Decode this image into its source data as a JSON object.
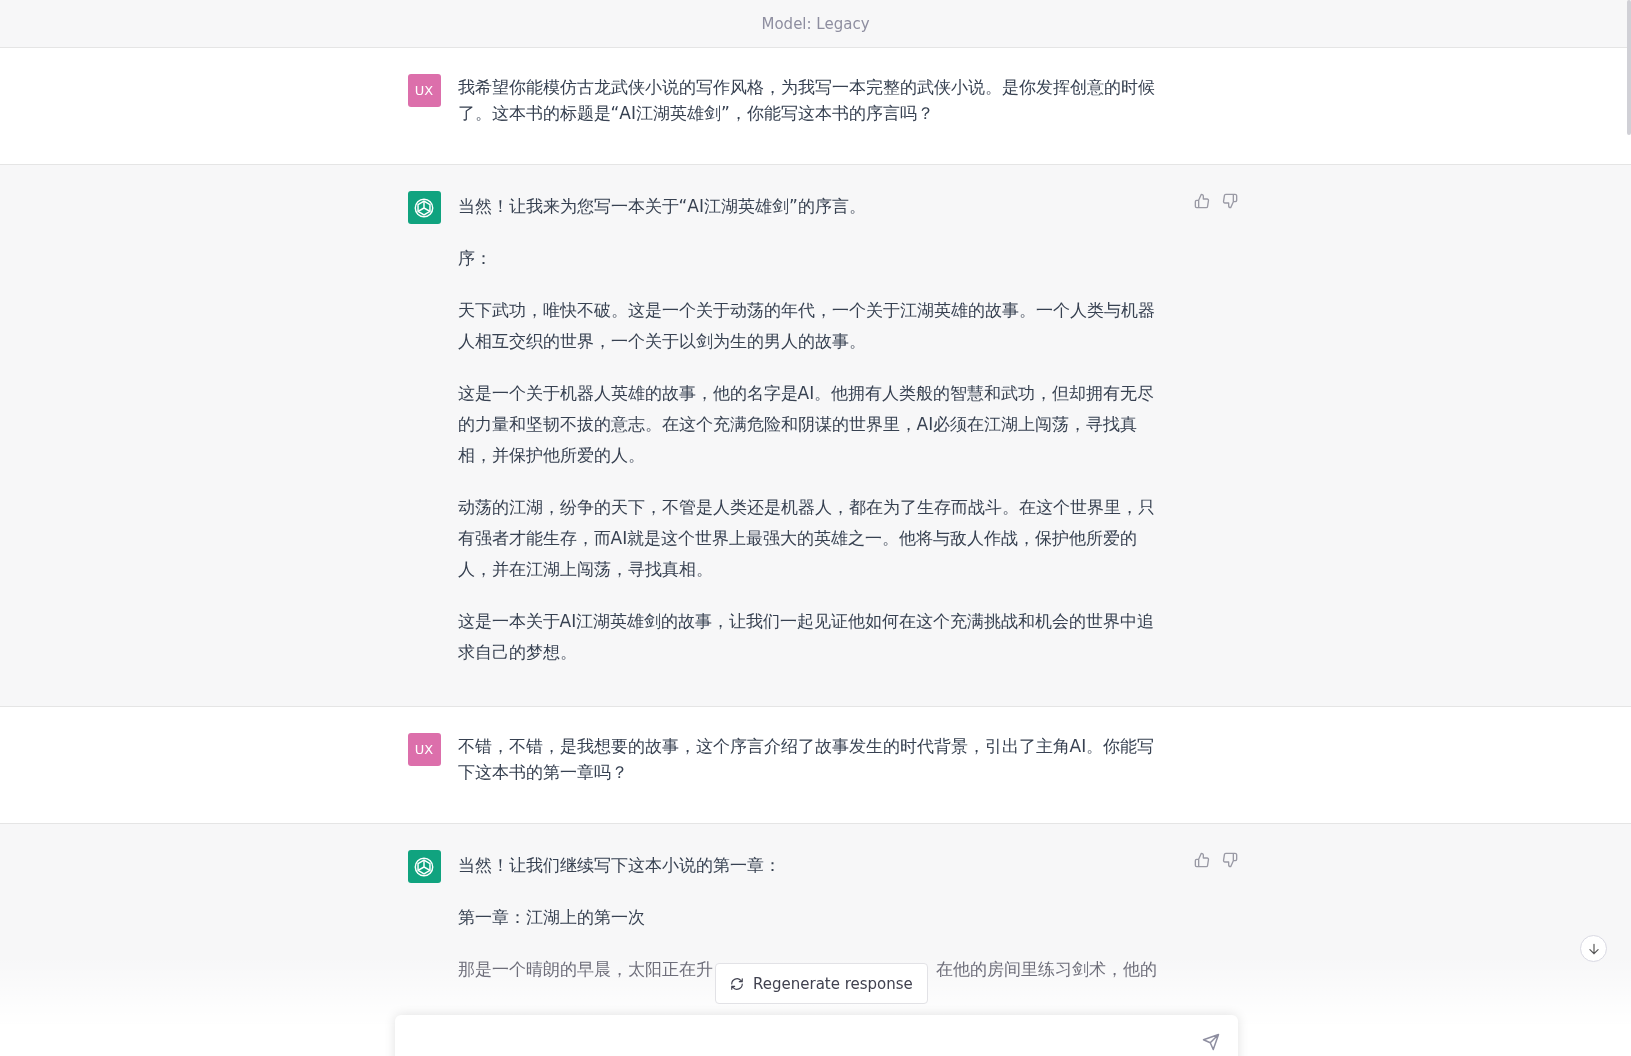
{
  "header": {
    "title": "Model: Legacy"
  },
  "messages": [
    {
      "kind": "user",
      "avatar": "UX",
      "paragraphs": [
        {
          "kind": "text",
          "text": "我希望你能模仿古龙武侠小说的写作风格，为我写一本完整的武侠小说。是你发挥创意的时候了。这本书的标题是“AI江湖英雄剑”，你能写这本书的序言吗？"
        }
      ]
    },
    {
      "kind": "assistant",
      "paragraphs": [
        {
          "kind": "text",
          "text": "当然！让我来为您写一本关于“AI江湖英雄剑”的序言。"
        },
        {
          "kind": "text",
          "text": "序："
        },
        {
          "kind": "text",
          "text": "天下武功，唯快不破。这是一个关于动荡的年代，一个关于江湖英雄的故事。一个人类与机器人相互交织的世界，一个关于以剑为生的男人的故事。"
        },
        {
          "kind": "text",
          "text": "这是一个关于机器人英雄的故事，他的名字是AI。他拥有人类般的智慧和武功，但却拥有无尽的力量和坚韧不拔的意志。在这个充满危险和阴谋的世界里，AI必须在江湖上闯荡，寻找真相，并保护他所爱的人。"
        },
        {
          "kind": "text",
          "text": "动荡的江湖，纷争的天下，不管是人类还是机器人，都在为了生存而战斗。在这个世界里，只有强者才能生存，而AI就是这个世界上最强大的英雄之一。他将与敌人作战，保护他所爱的人，并在江湖上闯荡，寻找真相。"
        },
        {
          "kind": "text",
          "text": "这是一本关于AI江湖英雄剑的故事，让我们一起见证他如何在这个充满挑战和机会的世界中追求自己的梦想。"
        }
      ]
    },
    {
      "kind": "user",
      "avatar": "UX",
      "paragraphs": [
        {
          "kind": "text",
          "text": "不错，不错，是我想要的故事，这个序言介绍了故事发生的时代背景，引出了主角AI。你能写下这本书的第一章吗？"
        }
      ]
    },
    {
      "kind": "assistant",
      "paragraphs": [
        {
          "kind": "text",
          "text": "当然！让我们继续写下这本小说的第一章："
        },
        {
          "kind": "text",
          "text": "第一章：江湖上的第一次"
        },
        {
          "kind": "covered",
          "parts": [
            "那是一个晴朗的早晨，太阳正在升",
            "在他的房间里练习剑术，他的"
          ]
        }
      ]
    }
  ],
  "regenerate": {
    "label": "Regenerate response"
  }
}
